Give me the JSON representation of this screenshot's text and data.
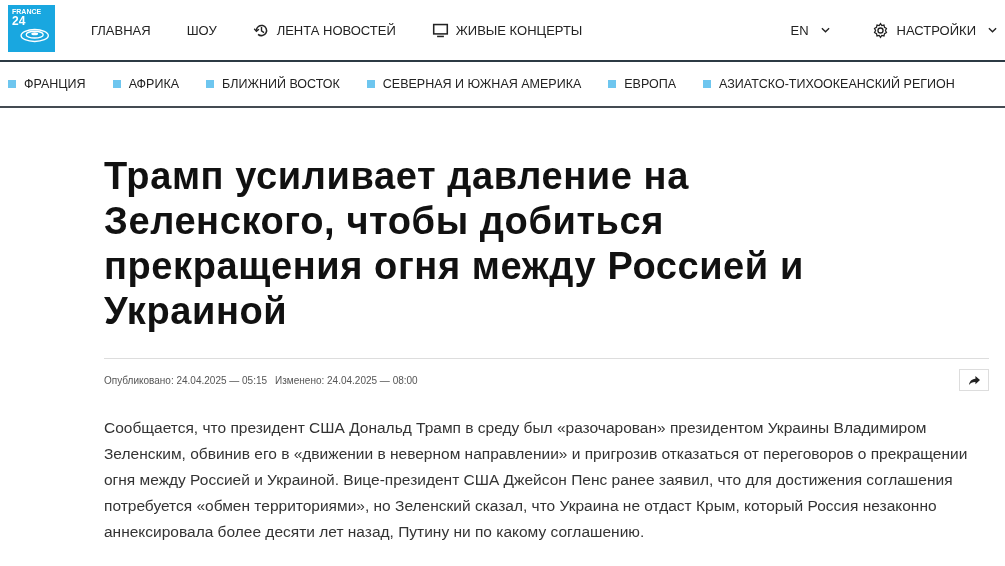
{
  "logo": {
    "line1": "FRANCE",
    "line2": "24"
  },
  "main_nav": [
    {
      "label": "ГЛАВНАЯ",
      "kind": "plain"
    },
    {
      "label": "ШОУ",
      "kind": "plain"
    },
    {
      "label": "ЛЕНТА НОВОСТЕЙ",
      "kind": "feed"
    },
    {
      "label": "ЖИВЫЕ КОНЦЕРТЫ",
      "kind": "live"
    }
  ],
  "language": {
    "label": "EN"
  },
  "settings": {
    "label": "НАСТРОЙКИ"
  },
  "regions": [
    {
      "label": "ФРАНЦИЯ",
      "color": "#6ec6ef"
    },
    {
      "label": "АФРИКА",
      "color": "#6ec6ef"
    },
    {
      "label": "БЛИЖНИЙ ВОСТОК",
      "color": "#6ec6ef"
    },
    {
      "label": "СЕВЕРНАЯ И ЮЖНАЯ АМЕРИКА",
      "color": "#6ec6ef"
    },
    {
      "label": "ЕВРОПА",
      "color": "#6ec6ef"
    },
    {
      "label": "АЗИАТСКО-ТИХООКЕАНСКИЙ РЕГИОН",
      "color": "#6ec6ef"
    }
  ],
  "article": {
    "title": "Трамп усиливает давление на Зеленского, чтобы добиться прекращения огня между Россией и Украиной",
    "published": "Опубликовано: 24.04.2025 — 05:15",
    "modified": "Изменено: 24.04.2025 — 08:00",
    "body": "Сообщается, что президент США Дональд Трамп в среду был «разочарован» президентом Украины Владимиром Зеленским, обвинив его в «движении в неверном направлении» и пригрозив отказаться от переговоров о прекращении огня между Россией и Украиной. Вице-президент США Джейсон Пенс ранее заявил, что для достижения соглашения потребуется «обмен территориями», но Зеленский сказал, что Украина не отдаст Крым, который Россия незаконно аннексировала более десяти лет назад, Путину ни по какому соглашению."
  }
}
